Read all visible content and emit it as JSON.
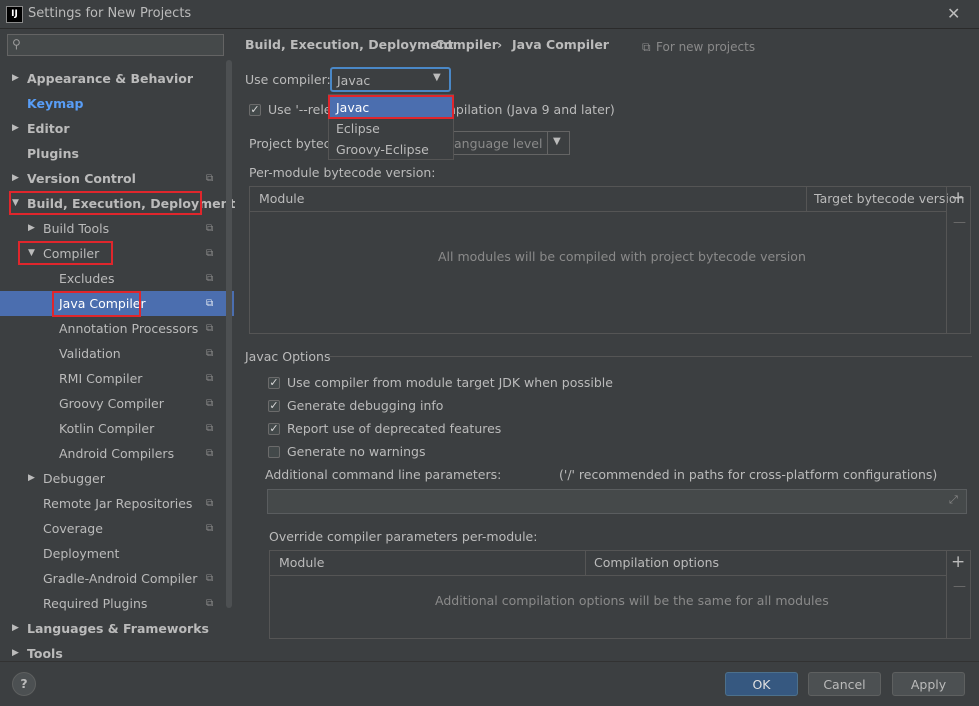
{
  "window": {
    "title": "Settings for New Projects",
    "app_icon": "IJ",
    "close": "✕"
  },
  "search": {
    "placeholder": ""
  },
  "tree": [
    {
      "label": "Appearance & Behavior",
      "level": 0,
      "arrow": "▶",
      "bold": true
    },
    {
      "label": "Keymap",
      "level": 0,
      "bold": true,
      "accent": true
    },
    {
      "label": "Editor",
      "level": 0,
      "arrow": "▶",
      "bold": true
    },
    {
      "label": "Plugins",
      "level": 0,
      "bold": true
    },
    {
      "label": "Version Control",
      "level": 0,
      "arrow": "▶",
      "bold": true,
      "cfg": true
    },
    {
      "label": "Build, Execution, Deployment",
      "level": 0,
      "arrow": "▼",
      "bold": true
    },
    {
      "label": "Build Tools",
      "level": 1,
      "arrow": "▶",
      "cfg": true
    },
    {
      "label": "Compiler",
      "level": 1,
      "arrow": "▼",
      "cfg": true
    },
    {
      "label": "Excludes",
      "level": 2,
      "cfg": true
    },
    {
      "label": "Java Compiler",
      "level": 2,
      "cfg": true,
      "selected": true
    },
    {
      "label": "Annotation Processors",
      "level": 2,
      "cfg": true
    },
    {
      "label": "Validation",
      "level": 2,
      "cfg": true
    },
    {
      "label": "RMI Compiler",
      "level": 2,
      "cfg": true
    },
    {
      "label": "Groovy Compiler",
      "level": 2,
      "cfg": true
    },
    {
      "label": "Kotlin Compiler",
      "level": 2,
      "cfg": true
    },
    {
      "label": "Android Compilers",
      "level": 2,
      "cfg": true
    },
    {
      "label": "Debugger",
      "level": 1,
      "arrow": "▶"
    },
    {
      "label": "Remote Jar Repositories",
      "level": 1,
      "cfg": true
    },
    {
      "label": "Coverage",
      "level": 1,
      "cfg": true
    },
    {
      "label": "Deployment",
      "level": 1
    },
    {
      "label": "Gradle-Android Compiler",
      "level": 1,
      "cfg": true
    },
    {
      "label": "Required Plugins",
      "level": 1,
      "cfg": true
    },
    {
      "label": "Languages & Frameworks",
      "level": 0,
      "arrow": "▶",
      "bold": true
    },
    {
      "label": "Tools",
      "level": 0,
      "arrow": "▶",
      "bold": true
    }
  ],
  "breadcrumb": {
    "part1": "Build, Execution, Deployment",
    "sep": "›",
    "part2": "Compiler",
    "part3": "Java Compiler",
    "scope": "For new projects",
    "scope_icon": "⧉"
  },
  "compiler": {
    "label": "Use compiler:",
    "value": "Javac",
    "options": [
      "Javac",
      "Eclipse",
      "Groovy-Eclipse"
    ],
    "selected_option": "Javac"
  },
  "release_option": {
    "label_left": "Use '--relea",
    "label_right": "npilation (Java 9 and later)",
    "checked": true
  },
  "bytecode": {
    "label": "Project byteco",
    "value": "anguage level"
  },
  "per_module": {
    "label": "Per-module bytecode version:",
    "col_module": "Module",
    "col_target": "Target bytecode version",
    "empty": "All modules will be compiled with project bytecode version"
  },
  "javac": {
    "section": "Javac Options",
    "options": [
      {
        "label": "Use compiler from module target JDK when possible",
        "checked": true
      },
      {
        "label": "Generate debugging info",
        "checked": true
      },
      {
        "label": "Report use of deprecated features",
        "checked": true
      },
      {
        "label": "Generate no warnings",
        "checked": false
      }
    ],
    "params_label": "Additional command line parameters:",
    "params_hint": "('/' recommended in paths for cross-platform configurations)",
    "params_value": ""
  },
  "override": {
    "label": "Override compiler parameters per-module:",
    "col_module": "Module",
    "col_options": "Compilation options",
    "empty": "Additional compilation options will be the same for all modules"
  },
  "footer": {
    "help": "?",
    "ok": "OK",
    "cancel": "Cancel",
    "apply": "Apply"
  }
}
